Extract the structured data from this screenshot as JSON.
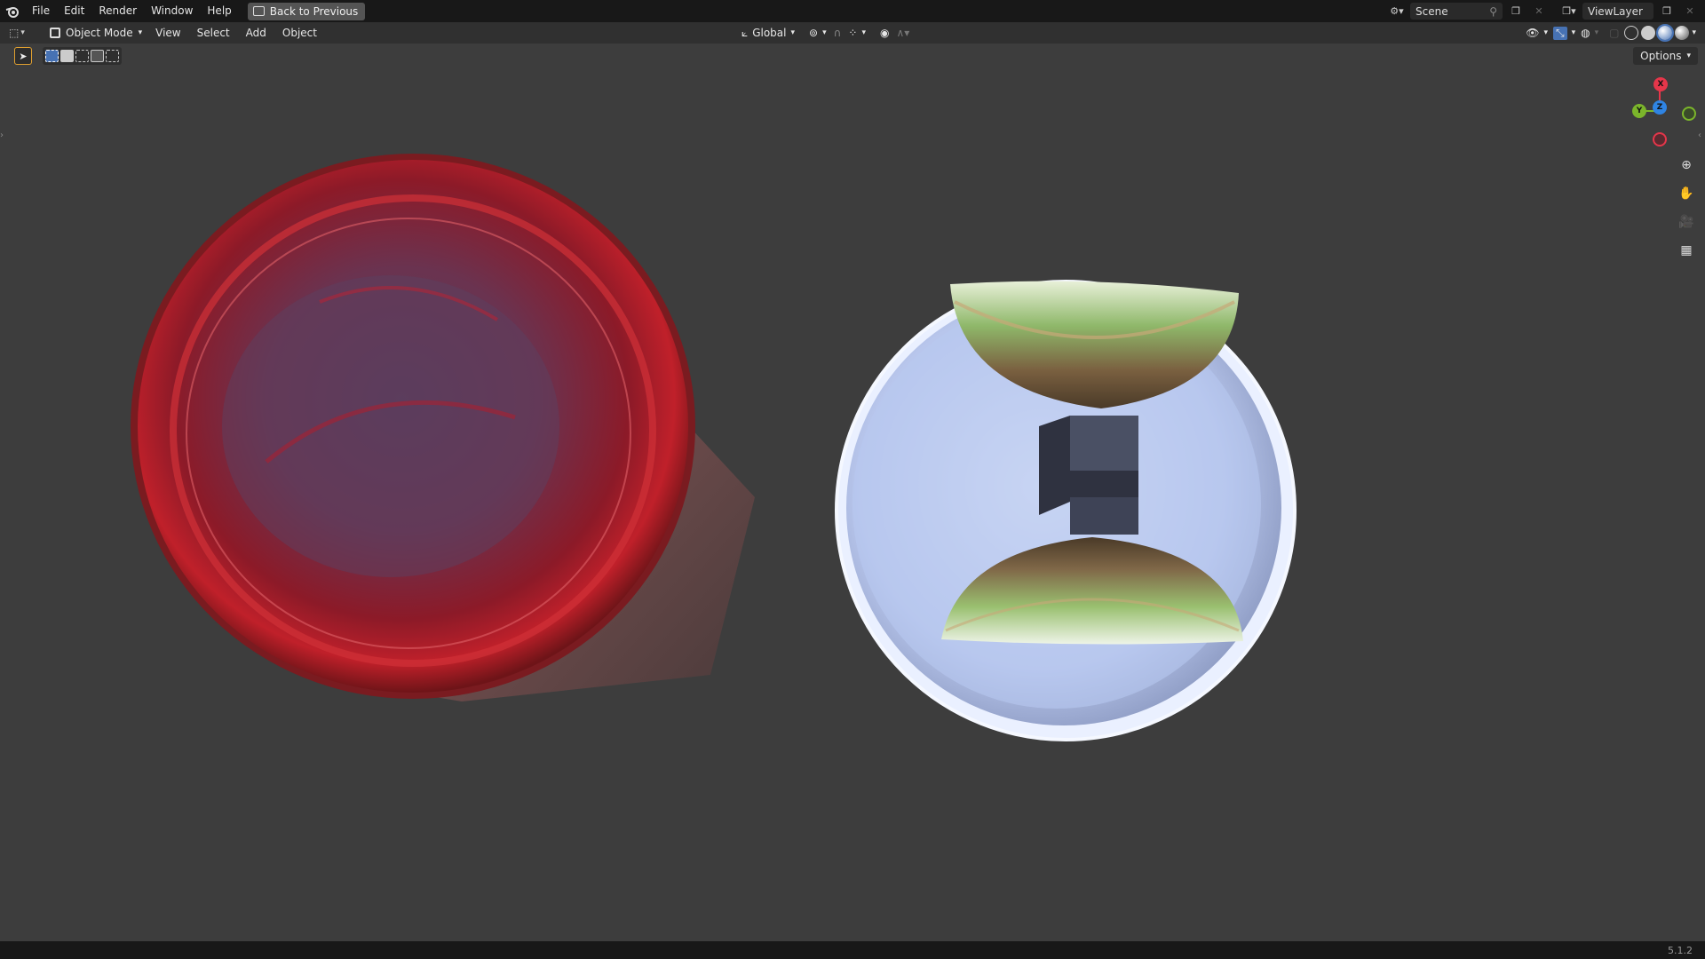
{
  "topbar": {
    "menus": [
      "File",
      "Edit",
      "Render",
      "Window",
      "Help"
    ],
    "back_button": "Back to Previous",
    "scene_name": "Scene",
    "view_layer": "ViewLayer"
  },
  "header": {
    "mode": "Object Mode",
    "menus": [
      "View",
      "Select",
      "Add",
      "Object"
    ],
    "transform_orientation": "Global",
    "options_label": "Options"
  },
  "gizmo": {
    "x_label": "X",
    "y_label": "Y",
    "z_label": "Z",
    "x_color": "#e5364a",
    "y_color": "#7bb52b",
    "z_color": "#2f84e3"
  },
  "statusbar": {
    "version": "5.1.2"
  },
  "icons": {
    "logo": "blender-logo-icon",
    "zoom": "zoom-icon",
    "pan": "hand-pan-icon",
    "camera": "camera-view-icon",
    "ortho": "grid-ortho-icon"
  }
}
